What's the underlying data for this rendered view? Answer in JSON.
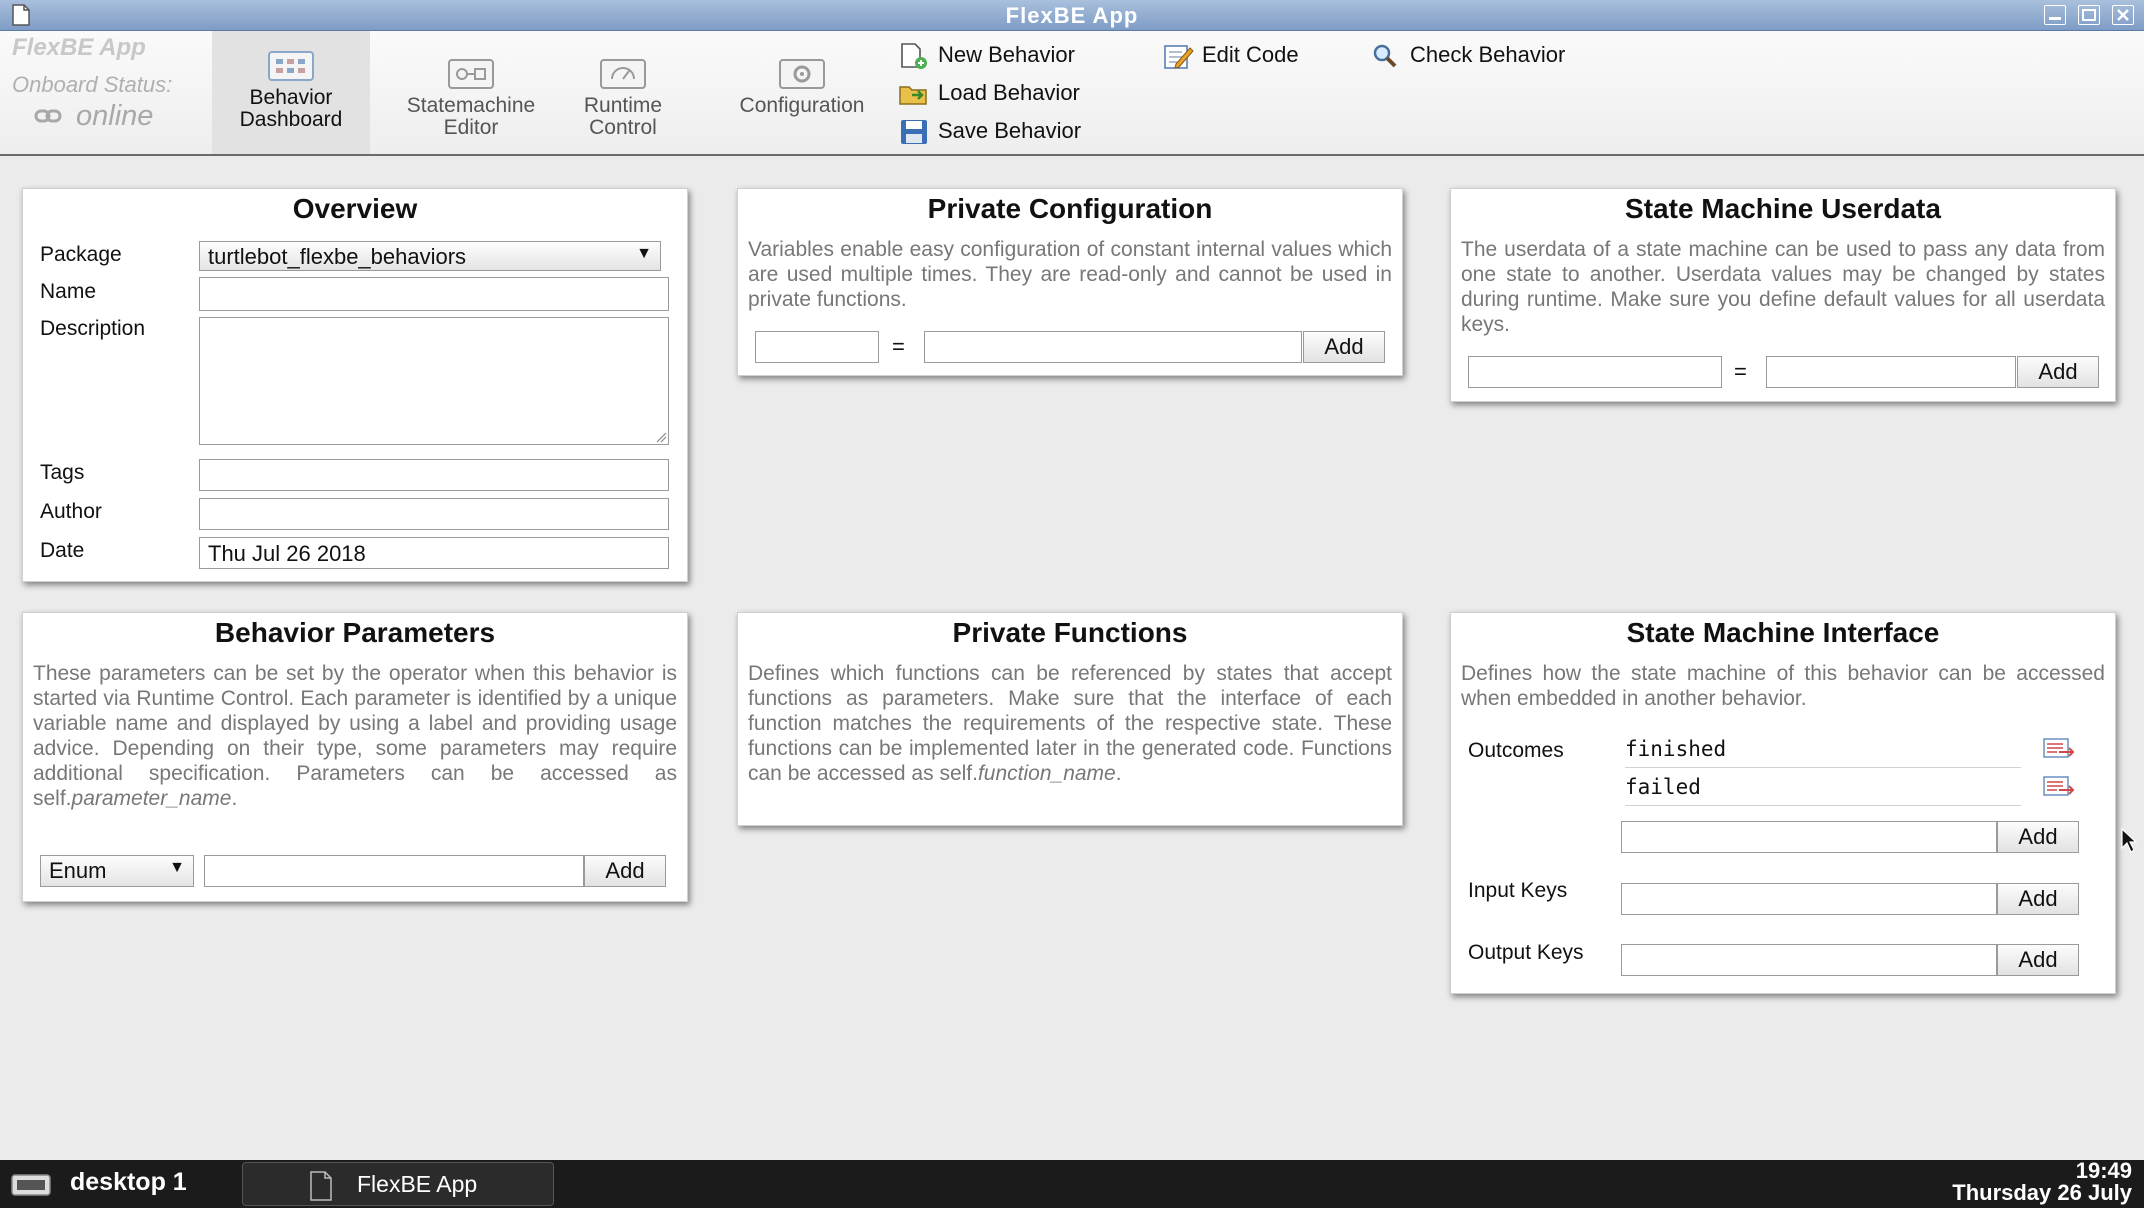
{
  "window": {
    "title": "FlexBE App"
  },
  "header": {
    "brand": "FlexBE App",
    "onboard_label": "Onboard Status:",
    "onboard_value": "online"
  },
  "nav": [
    {
      "label": "Behavior Dashboard",
      "active": true
    },
    {
      "label": "Statemachine Editor",
      "active": false
    },
    {
      "label": "Runtime Control",
      "active": false
    },
    {
      "label": "Configuration",
      "active": false
    }
  ],
  "actions": {
    "new_behavior": "New Behavior",
    "load_behavior": "Load Behavior",
    "save_behavior": "Save Behavior",
    "edit_code": "Edit Code",
    "check_behavior": "Check Behavior"
  },
  "overview": {
    "title": "Overview",
    "package_label": "Package",
    "package_value": "turtlebot_flexbe_behaviors",
    "name_label": "Name",
    "name_value": "",
    "description_label": "Description",
    "description_value": "",
    "tags_label": "Tags",
    "tags_value": "",
    "author_label": "Author",
    "author_value": "",
    "date_label": "Date",
    "date_value": "Thu Jul 26 2018"
  },
  "private_configuration": {
    "title": "Private Configuration",
    "description": "Variables enable easy configuration of constant internal values which are used multiple times. They are read-only and cannot be used in private functions.",
    "equals": "=",
    "add_label": "Add"
  },
  "userdata": {
    "title": "State Machine Userdata",
    "description": "The userdata of a state machine can be used to pass any data from one state to another. Userdata values may be changed by states during runtime. Make sure you define default values for all userdata keys.",
    "equals": "=",
    "add_label": "Add"
  },
  "parameters": {
    "title": "Behavior Parameters",
    "description_pre": "These parameters can be set by the operator when this behavior is started via Runtime Control. Each parameter is identified by a unique variable name and displayed by using a label and providing usage advice. Depending on their type, some parameters may require additional specification. Parameters can be accessed as self.",
    "description_em": "parameter_name",
    "description_post": ".",
    "type_value": "Enum",
    "add_label": "Add"
  },
  "private_functions": {
    "title": "Private Functions",
    "description_pre": "Defines which functions can be referenced by states that accept functions as parameters. Make sure that the interface of each function matches the requirements of the respective state. These functions can be implemented later in the generated code. Functions can be accessed as self.",
    "description_em": "function_name",
    "description_post": "."
  },
  "interface": {
    "title": "State Machine Interface",
    "description": "Defines how the state machine of this behavior can be accessed when embedded in another behavior.",
    "outcomes_label": "Outcomes",
    "outcomes": [
      "finished",
      "failed"
    ],
    "input_keys_label": "Input Keys",
    "output_keys_label": "Output Keys",
    "add_label": "Add"
  },
  "taskbar": {
    "desktop": "desktop 1",
    "task_label": "FlexBE App",
    "time": "19:49",
    "date": "Thursday 26 July"
  }
}
